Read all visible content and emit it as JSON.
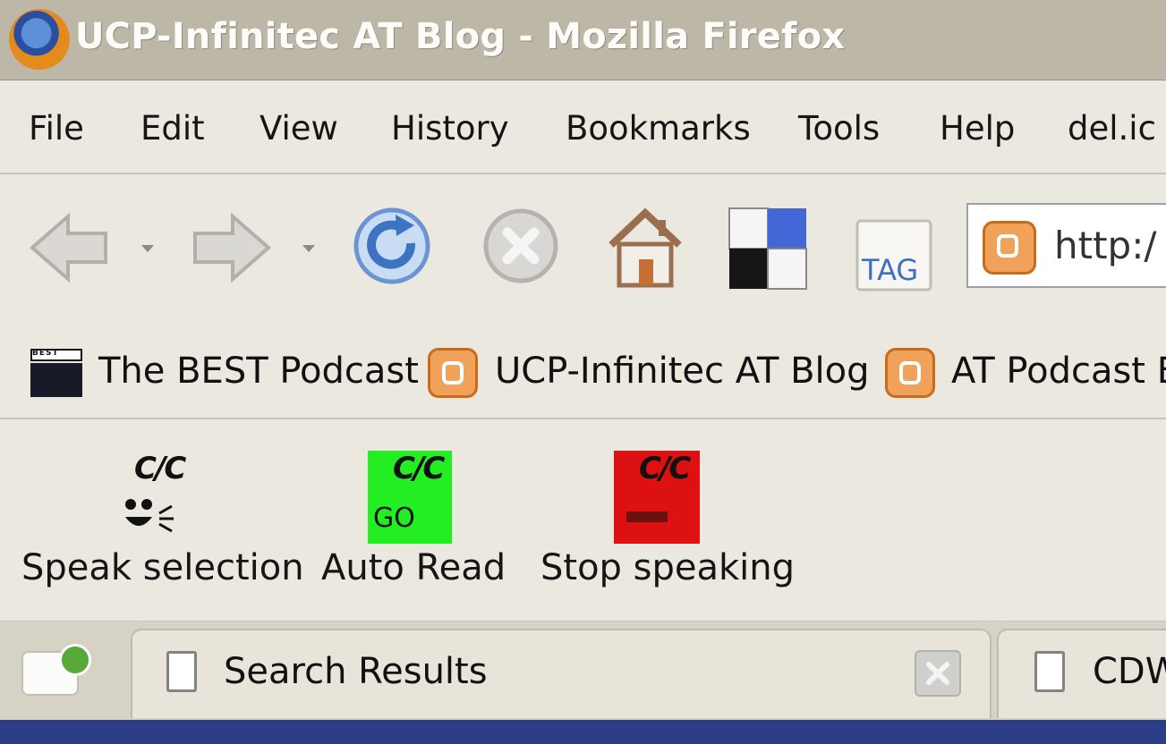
{
  "window": {
    "title": "UCP-Infinitec AT Blog - Mozilla Firefox"
  },
  "menu": {
    "items": [
      "File",
      "Edit",
      "View",
      "History",
      "Bookmarks",
      "Tools",
      "Help",
      "del.ic"
    ]
  },
  "navigation": {
    "buttons": [
      "back-button",
      "forward-button",
      "reload-button",
      "stop-button",
      "home-button",
      "delicious-button",
      "tag-button"
    ],
    "tag_label": "TAG",
    "url": "http:/"
  },
  "bookmarks": {
    "items": [
      "The BEST Podcast",
      "UCP-Infinitec AT Blog",
      "AT Podcast B"
    ],
    "best_badge": "BEST"
  },
  "speech_toolbar": {
    "items": [
      "Speak selection",
      "Auto Read",
      "Stop speaking"
    ],
    "icon_text": "C/C",
    "go_text": "GO"
  },
  "tabs": {
    "items": [
      "Search Results",
      "CDW"
    ]
  },
  "colors": {
    "green_button": "#22ee22",
    "red_button": "#dd1111",
    "blogger_orange": "#f0a25a"
  }
}
